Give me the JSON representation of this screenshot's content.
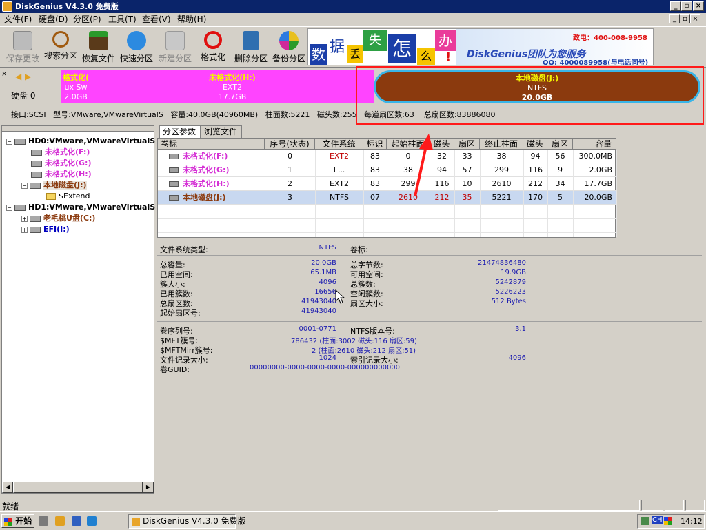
{
  "window": {
    "title": "DiskGenius V4.3.0 免费版"
  },
  "menu": [
    "文件(F)",
    "硬盘(D)",
    "分区(P)",
    "工具(T)",
    "查看(V)",
    "帮助(H)"
  ],
  "toolbar": [
    "保存更改",
    "搜索分区",
    "恢复文件",
    "快速分区",
    "新建分区",
    "格式化",
    "删除分区",
    "备份分区"
  ],
  "banner": {
    "chars": [
      "数",
      "据",
      "丢",
      "失",
      "怎",
      "么",
      "办",
      "!"
    ],
    "service": "DiskGenius团队为您服务",
    "phone": "致电：400-008-9958",
    "qq": "QQ: 4000089958(与电话同号)"
  },
  "disk_bar": {
    "label": "硬盘 0",
    "p1": {
      "name": "格式化(",
      "fs": "ux Sw",
      "size": "2.0GB"
    },
    "p2": {
      "name": "未格式化(H:)",
      "fs": "EXT2",
      "size": "17.7GB"
    },
    "p3": {
      "name": "本地磁盘(J:)",
      "fs": "NTFS",
      "size": "20.0GB"
    },
    "info": {
      "interface": "接口:SCSI",
      "model": "型号:VMware,VMwareVirtualS",
      "capacity": "容量:40.0GB(40960MB)",
      "cylinders": "柱面数:5221",
      "heads": "磁头数:255",
      "sectors_per_track": "每道扇区数:63",
      "total_sectors": "总扇区数:83886080"
    }
  },
  "tree": {
    "hd0": "HD0:VMware,VMwareVirtualS",
    "hd0_parts": [
      "未格式化(F:)",
      "未格式化(G:)",
      "未格式化(H:)",
      "本地磁盘(J:)"
    ],
    "extend": "$Extend",
    "hd1": "HD1:VMware,VMwareVirtualS",
    "hd1_parts": [
      "老毛桃U盘(C:)",
      "EFI(I:)"
    ]
  },
  "tabs": [
    "分区参数",
    "浏览文件"
  ],
  "table": {
    "columns": [
      "卷标",
      "序号(状态)",
      "文件系统",
      "标识",
      "起始柱面",
      "磁头",
      "扇区",
      "终止柱面",
      "磁头",
      "扇区",
      "容量"
    ],
    "rows": [
      [
        "未格式化(F:)",
        "0",
        "EXT2",
        "83",
        "0",
        "32",
        "33",
        "38",
        "94",
        "56",
        "300.0MB"
      ],
      [
        "未格式化(G:)",
        "1",
        "L...",
        "83",
        "38",
        "94",
        "57",
        "299",
        "116",
        "9",
        "2.0GB"
      ],
      [
        "未格式化(H:)",
        "2",
        "EXT2",
        "83",
        "299",
        "116",
        "10",
        "2610",
        "212",
        "34",
        "17.7GB"
      ],
      [
        "本地磁盘(J:)",
        "3",
        "NTFS",
        "07",
        "2610",
        "212",
        "35",
        "5221",
        "170",
        "5",
        "20.0GB"
      ]
    ]
  },
  "details": {
    "fs_type_label": "文件系统类型:",
    "fs_type": "NTFS",
    "vol_label": "卷标:",
    "left": [
      [
        "总容量:",
        "20.0GB"
      ],
      [
        "已用空间:",
        "65.1MB"
      ],
      [
        "簇大小:",
        "4096"
      ],
      [
        "已用簇数:",
        "16656"
      ],
      [
        "总扇区数:",
        "41943040"
      ],
      [
        "起始扇区号:",
        "41943040"
      ]
    ],
    "right": [
      [
        "总字节数:",
        "21474836480"
      ],
      [
        "可用空间:",
        "19.9GB"
      ],
      [
        "总簇数:",
        "5242879"
      ],
      [
        "空闲簇数:",
        "5226223"
      ],
      [
        "扇区大小:",
        "512 Bytes"
      ]
    ],
    "left2": [
      [
        "卷序列号:",
        "0001-0771"
      ],
      [
        "$MFT簇号:",
        "786432 (柱面:3002 磁头:116 扇区:59)"
      ],
      [
        "$MFTMirr簇号:",
        "2 (柱面:2610 磁头:212 扇区:51)"
      ],
      [
        "文件记录大小:",
        "1024"
      ],
      [
        "卷GUID:",
        "00000000-0000-0000-0000-000000000000"
      ]
    ],
    "right2": [
      [
        "NTFS版本号:",
        "3.1"
      ],
      [
        "",
        ""
      ],
      [
        "",
        ""
      ],
      [
        "索引记录大小:",
        "4096"
      ]
    ]
  },
  "status": "就绪",
  "taskbar": {
    "start": "开始",
    "app": "DiskGenius V4.3.0 免费版",
    "ime": "CH",
    "time": "14:12"
  }
}
